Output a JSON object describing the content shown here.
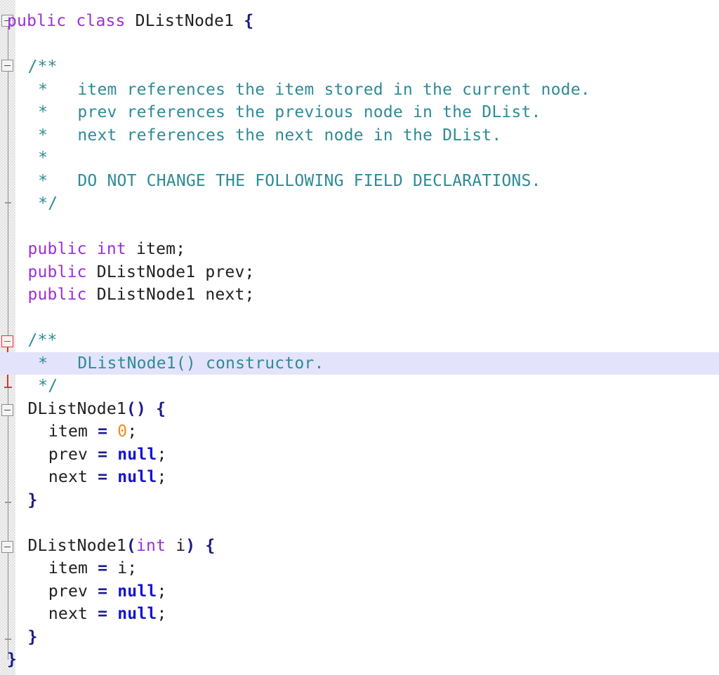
{
  "editor": {
    "language": "java",
    "file_type": "Java source",
    "colors": {
      "background": "#ffffff",
      "keyword": "#9b30d9",
      "comment": "#2e8b96",
      "plain_text": "#202020",
      "operator": "#1a1a8c",
      "literal": "#1414d2",
      "number": "#ef8c1e",
      "current_line_highlight": "#e3e3fb",
      "gutter_background": "#f2f2f2",
      "fold_marker": "#8c8c8c",
      "fold_marker_error": "#e83232"
    },
    "gutter": {
      "name": "folding-margin",
      "markers": [
        {
          "type": "fold-minus",
          "line": 1,
          "state": "expanded",
          "color": "normal"
        },
        {
          "type": "fold-minus",
          "line": 3,
          "state": "expanded",
          "color": "normal"
        },
        {
          "type": "fold-minus",
          "line": 15,
          "state": "expanded",
          "color": "error"
        },
        {
          "type": "fold-minus",
          "line": 18,
          "state": "expanded",
          "color": "normal"
        },
        {
          "type": "fold-minus",
          "line": 24,
          "state": "expanded",
          "color": "normal"
        }
      ]
    },
    "current_line": 16,
    "lines": [
      {
        "n": 1,
        "indent": 0,
        "tokens": [
          {
            "t": "public",
            "c": "kw"
          },
          {
            "t": " ",
            "c": "plain"
          },
          {
            "t": "class",
            "c": "kw"
          },
          {
            "t": " ",
            "c": "plain"
          },
          {
            "t": "DListNode1",
            "c": "plain"
          },
          {
            "t": " ",
            "c": "plain"
          },
          {
            "t": "{",
            "c": "op"
          }
        ]
      },
      {
        "n": 2,
        "indent": 0,
        "tokens": []
      },
      {
        "n": 3,
        "indent": 2,
        "tokens": [
          {
            "t": "/**",
            "c": "cmt"
          }
        ]
      },
      {
        "n": 4,
        "indent": 3,
        "tokens": [
          {
            "t": "*   item references the item stored in the current node.",
            "c": "cmt"
          }
        ]
      },
      {
        "n": 5,
        "indent": 3,
        "tokens": [
          {
            "t": "*   prev references the previous node in the DList.",
            "c": "cmt"
          }
        ]
      },
      {
        "n": 6,
        "indent": 3,
        "tokens": [
          {
            "t": "*   next references the next node in the DList.",
            "c": "cmt"
          }
        ]
      },
      {
        "n": 7,
        "indent": 3,
        "tokens": [
          {
            "t": "*",
            "c": "cmt"
          }
        ]
      },
      {
        "n": 8,
        "indent": 3,
        "tokens": [
          {
            "t": "*   DO NOT CHANGE THE FOLLOWING FIELD DECLARATIONS.",
            "c": "cmt"
          }
        ]
      },
      {
        "n": 9,
        "indent": 3,
        "tokens": [
          {
            "t": "*/",
            "c": "cmt"
          }
        ]
      },
      {
        "n": 10,
        "indent": 0,
        "tokens": []
      },
      {
        "n": 11,
        "indent": 2,
        "tokens": [
          {
            "t": "public",
            "c": "kw"
          },
          {
            "t": " ",
            "c": "plain"
          },
          {
            "t": "int",
            "c": "kw"
          },
          {
            "t": " ",
            "c": "plain"
          },
          {
            "t": "item;",
            "c": "plain"
          }
        ]
      },
      {
        "n": 12,
        "indent": 2,
        "tokens": [
          {
            "t": "public",
            "c": "kw"
          },
          {
            "t": " ",
            "c": "plain"
          },
          {
            "t": "DListNode1 prev;",
            "c": "plain"
          }
        ]
      },
      {
        "n": 13,
        "indent": 2,
        "tokens": [
          {
            "t": "public",
            "c": "kw"
          },
          {
            "t": " ",
            "c": "plain"
          },
          {
            "t": "DListNode1 next;",
            "c": "plain"
          }
        ]
      },
      {
        "n": 14,
        "indent": 0,
        "tokens": []
      },
      {
        "n": 15,
        "indent": 2,
        "tokens": [
          {
            "t": "/**",
            "c": "cmt"
          }
        ]
      },
      {
        "n": 16,
        "indent": 3,
        "tokens": [
          {
            "t": "*   DListNode1() constructor.",
            "c": "cmt"
          }
        ],
        "highlight": true
      },
      {
        "n": 17,
        "indent": 3,
        "tokens": [
          {
            "t": "*/",
            "c": "cmt"
          }
        ]
      },
      {
        "n": 18,
        "indent": 2,
        "tokens": [
          {
            "t": "DListNode1",
            "c": "plain"
          },
          {
            "t": "()",
            "c": "op"
          },
          {
            "t": " ",
            "c": "plain"
          },
          {
            "t": "{",
            "c": "op"
          }
        ]
      },
      {
        "n": 19,
        "indent": 4,
        "tokens": [
          {
            "t": "item ",
            "c": "plain"
          },
          {
            "t": "=",
            "c": "op"
          },
          {
            "t": " ",
            "c": "plain"
          },
          {
            "t": "0",
            "c": "num"
          },
          {
            "t": ";",
            "c": "plain"
          }
        ]
      },
      {
        "n": 20,
        "indent": 4,
        "tokens": [
          {
            "t": "prev ",
            "c": "plain"
          },
          {
            "t": "=",
            "c": "op"
          },
          {
            "t": " ",
            "c": "plain"
          },
          {
            "t": "null",
            "c": "lit"
          },
          {
            "t": ";",
            "c": "plain"
          }
        ]
      },
      {
        "n": 21,
        "indent": 4,
        "tokens": [
          {
            "t": "next ",
            "c": "plain"
          },
          {
            "t": "=",
            "c": "op"
          },
          {
            "t": " ",
            "c": "plain"
          },
          {
            "t": "null",
            "c": "lit"
          },
          {
            "t": ";",
            "c": "plain"
          }
        ]
      },
      {
        "n": 22,
        "indent": 2,
        "tokens": [
          {
            "t": "}",
            "c": "op"
          }
        ]
      },
      {
        "n": 23,
        "indent": 0,
        "tokens": []
      },
      {
        "n": 24,
        "indent": 2,
        "tokens": [
          {
            "t": "DListNode1",
            "c": "plain"
          },
          {
            "t": "(",
            "c": "op"
          },
          {
            "t": "int",
            "c": "kw"
          },
          {
            "t": " i",
            "c": "plain"
          },
          {
            "t": ")",
            "c": "op"
          },
          {
            "t": " ",
            "c": "plain"
          },
          {
            "t": "{",
            "c": "op"
          }
        ]
      },
      {
        "n": 25,
        "indent": 4,
        "tokens": [
          {
            "t": "item ",
            "c": "plain"
          },
          {
            "t": "=",
            "c": "op"
          },
          {
            "t": " i;",
            "c": "plain"
          }
        ]
      },
      {
        "n": 26,
        "indent": 4,
        "tokens": [
          {
            "t": "prev ",
            "c": "plain"
          },
          {
            "t": "=",
            "c": "op"
          },
          {
            "t": " ",
            "c": "plain"
          },
          {
            "t": "null",
            "c": "lit"
          },
          {
            "t": ";",
            "c": "plain"
          }
        ]
      },
      {
        "n": 27,
        "indent": 4,
        "tokens": [
          {
            "t": "next ",
            "c": "plain"
          },
          {
            "t": "=",
            "c": "op"
          },
          {
            "t": " ",
            "c": "plain"
          },
          {
            "t": "null",
            "c": "lit"
          },
          {
            "t": ";",
            "c": "plain"
          }
        ]
      },
      {
        "n": 28,
        "indent": 2,
        "tokens": [
          {
            "t": "}",
            "c": "op"
          }
        ]
      },
      {
        "n": 29,
        "indent": 0,
        "tokens": [
          {
            "t": "}",
            "c": "op"
          }
        ]
      }
    ]
  }
}
